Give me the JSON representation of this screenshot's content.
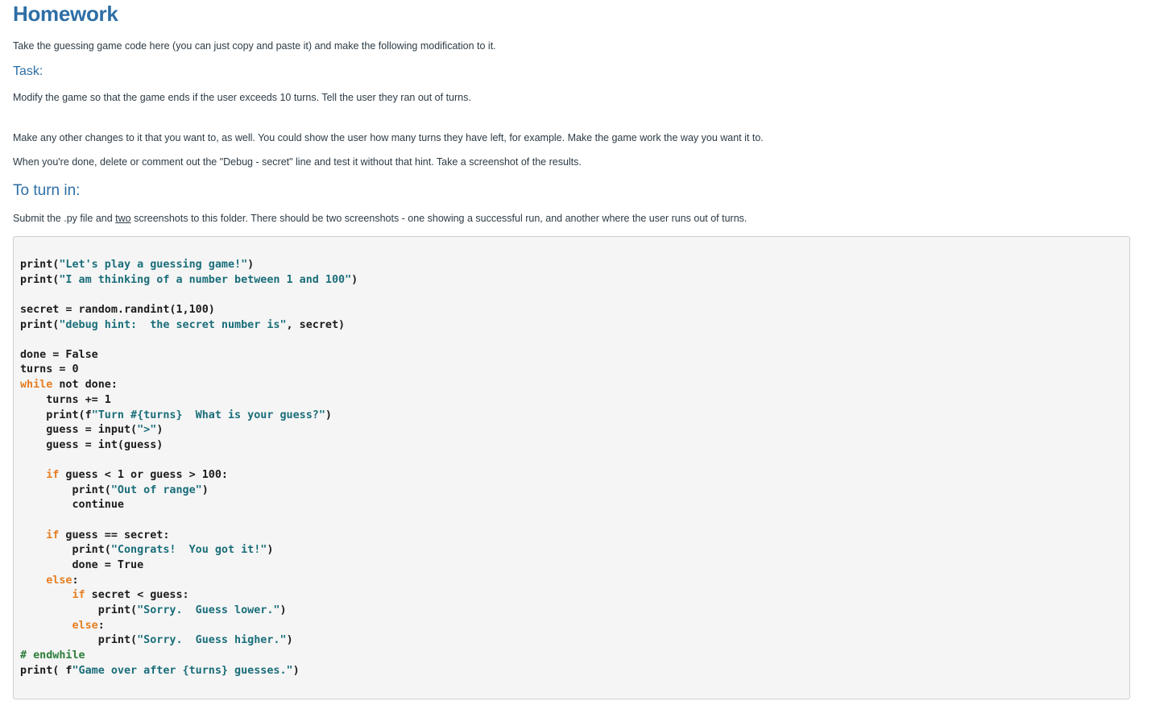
{
  "page": {
    "title": "Homework",
    "intro": "Take the guessing game code here (you can just copy and paste it) and make the following modification to it.",
    "task_heading": "Task:",
    "task_text": "Modify the game so that the game ends if the user exceeds 10 turns.  Tell the user they ran out of turns.",
    "changes_text": "Make any other changes to it that you want to, as well.  You could show the user how many turns they have left, for example.  Make the game work the way you want it to.",
    "done_text": "When you're done, delete or comment out the \"Debug - secret\" line and test it without that hint.  Take a screenshot of the results.",
    "turnin_heading": "To turn in:",
    "submit_before": "Submit the .py file and ",
    "submit_underlined": "two",
    "submit_after": " screenshots to this folder.  There should be two screenshots - one showing a successful run, and another where the user runs out of turns."
  },
  "code": {
    "lines": [
      [
        [
          "t",
          "print("
        ],
        [
          "s",
          "\"Let's play a guessing game!\""
        ],
        [
          "t",
          ")"
        ]
      ],
      [
        [
          "t",
          "print("
        ],
        [
          "s",
          "\"I am thinking of a number between 1 and 100\""
        ],
        [
          "t",
          ")"
        ]
      ],
      [],
      [
        [
          "t",
          "secret = random.randint(1,100)"
        ]
      ],
      [
        [
          "t",
          "print("
        ],
        [
          "s",
          "\"debug hint:  the secret number is\""
        ],
        [
          "t",
          ", secret)"
        ]
      ],
      [],
      [
        [
          "t",
          "done = False"
        ]
      ],
      [
        [
          "t",
          "turns = 0"
        ]
      ],
      [
        [
          "k",
          "while"
        ],
        [
          "t",
          " not done:"
        ]
      ],
      [
        [
          "t",
          "    turns += 1"
        ]
      ],
      [
        [
          "t",
          "    print(f"
        ],
        [
          "s",
          "\"Turn #{turns}  What is your guess?\""
        ],
        [
          "t",
          ")"
        ]
      ],
      [
        [
          "t",
          "    guess = input("
        ],
        [
          "s",
          "\">\""
        ],
        [
          "t",
          ")"
        ]
      ],
      [
        [
          "t",
          "    guess = int(guess)"
        ]
      ],
      [],
      [
        [
          "t",
          "    "
        ],
        [
          "k",
          "if"
        ],
        [
          "t",
          " guess < 1 or guess > 100:"
        ]
      ],
      [
        [
          "t",
          "        print("
        ],
        [
          "s",
          "\"Out of range\""
        ],
        [
          "t",
          ")"
        ]
      ],
      [
        [
          "t",
          "        continue"
        ]
      ],
      [],
      [
        [
          "t",
          "    "
        ],
        [
          "k",
          "if"
        ],
        [
          "t",
          " guess == secret:"
        ]
      ],
      [
        [
          "t",
          "        print("
        ],
        [
          "s",
          "\"Congrats!  You got it!\""
        ],
        [
          "t",
          ")"
        ]
      ],
      [
        [
          "t",
          "        done = True"
        ]
      ],
      [
        [
          "t",
          "    "
        ],
        [
          "k",
          "else"
        ],
        [
          "t",
          ":"
        ]
      ],
      [
        [
          "t",
          "        "
        ],
        [
          "k",
          "if"
        ],
        [
          "t",
          " secret < guess:"
        ]
      ],
      [
        [
          "t",
          "            print("
        ],
        [
          "s",
          "\"Sorry.  Guess lower.\""
        ],
        [
          "t",
          ")"
        ]
      ],
      [
        [
          "t",
          "        "
        ],
        [
          "k",
          "else"
        ],
        [
          "t",
          ":"
        ]
      ],
      [
        [
          "t",
          "            print("
        ],
        [
          "s",
          "\"Sorry.  Guess higher.\""
        ],
        [
          "t",
          ")"
        ]
      ],
      [
        [
          "c",
          "# endwhile"
        ]
      ],
      [
        [
          "t",
          "print( f"
        ],
        [
          "s",
          "\"Game over after {turns} guesses.\""
        ],
        [
          "t",
          ")"
        ]
      ]
    ]
  },
  "colors": {
    "heading": "#2d6ea5",
    "string": "#1a6e7a",
    "keyword": "#e67e22",
    "comment": "#2d7d3a",
    "code_background": "#f5f5f5"
  }
}
